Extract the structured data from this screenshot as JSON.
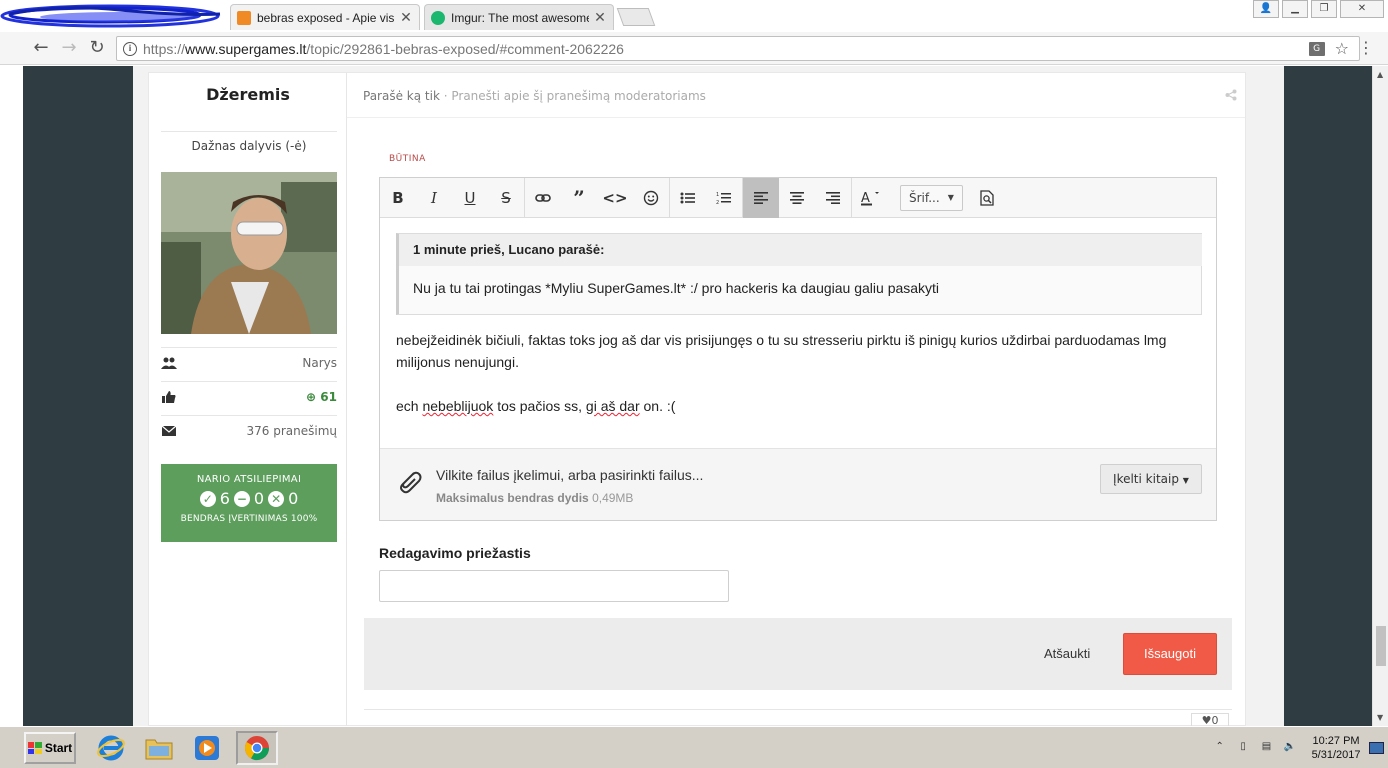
{
  "browser": {
    "tabs": [
      {
        "title": "bebras exposed - Apie viską",
        "active": true
      },
      {
        "title": "Imgur: The most awesome images",
        "active": false
      }
    ],
    "url_scheme": "https://",
    "url_host": "www.supergames.lt",
    "url_path": "/topic/292861-bebras-exposed/#comment-2062226"
  },
  "author": {
    "name": "Džeremis",
    "rank": "Dažnas dalyvis (-ė)",
    "group": "Narys",
    "reputation": "61",
    "posts": "376 pranešimų",
    "feedback": {
      "title": "NARIO ATSILIEPIMAI",
      "positive": "6",
      "neutral": "0",
      "negative": "0",
      "footer": "BENDRAS ĮVERTINIMAS 100%"
    }
  },
  "post": {
    "posted": "Parašė ką tik",
    "report": "· Pranešti apie šį pranešimą moderatoriams",
    "required": "BŪTINA",
    "font_select": "Šrif...",
    "quote_head": "1 minute prieš, Lucano parašė:",
    "quote_text": "Nu ja tu tai protingas *Myliu SuperGames.lt* :/ pro hackeris ka daugiau galiu pasakyti",
    "msg1": "nebejžeidinėk bičiuli, faktas toks jog aš dar vis prisijungęs o tu su stresseriu pirktu iš pinigų kurios uždirbai parduodamas lmg milijonus nenujungi.",
    "msg2_a": "ech",
    "msg2_b": "nebeblijuok",
    "msg2_c": "tos pačios ss,",
    "msg2_d": "gi aš dar",
    "msg2_e": "on. :(",
    "attach_text": "Vilkite failus įkelimui, arba pasirinkti failus...",
    "attach_max_label": "Maksimalus bendras dydis",
    "attach_max_value": "0,49MB",
    "upload_other": "Įkelti kitaip",
    "reason_label": "Redagavimo priežastis",
    "cancel": "Atšaukti",
    "save": "Išsaugoti",
    "likes": "0"
  },
  "taskbar": {
    "start": "Start",
    "time": "10:27 PM",
    "date": "5/31/2017"
  }
}
